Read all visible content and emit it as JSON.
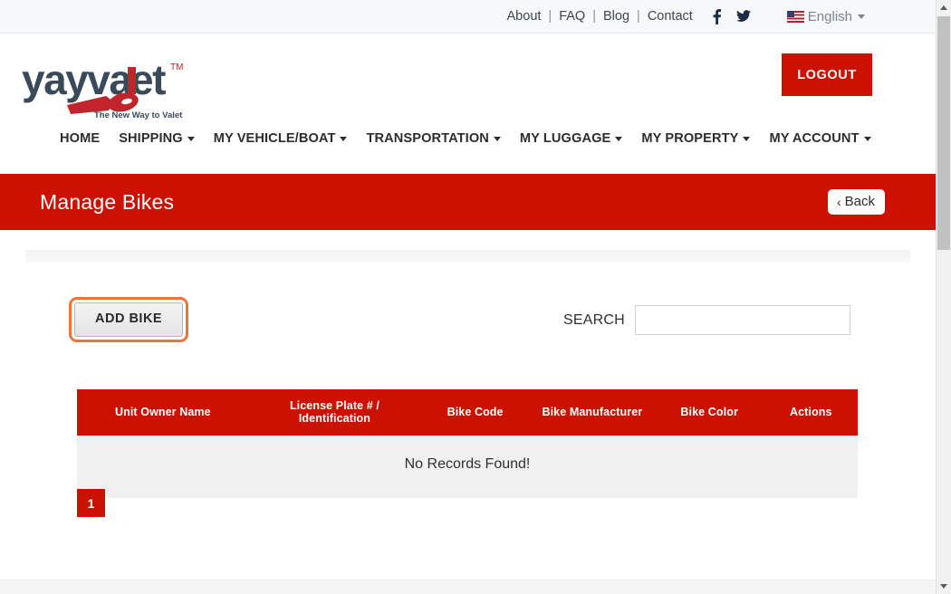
{
  "topbar": {
    "links": [
      {
        "label": "About"
      },
      {
        "label": "FAQ"
      },
      {
        "label": "Blog"
      },
      {
        "label": "Contact"
      }
    ],
    "separator": "|",
    "social": [
      {
        "name": "facebook-icon",
        "label": "Facebook"
      },
      {
        "name": "twitter-icon",
        "label": "Twitter"
      }
    ],
    "language": {
      "label": "English",
      "flag": "us-flag-icon"
    }
  },
  "header": {
    "logo": {
      "text": "yayvalet",
      "trademark": "TM",
      "tagline": "The New Way to Valet"
    },
    "logout_label": "LOGOUT",
    "nav": [
      {
        "label": "HOME",
        "has_caret": false
      },
      {
        "label": "SHIPPING",
        "has_caret": true
      },
      {
        "label": "MY VEHICLE/BOAT",
        "has_caret": true
      },
      {
        "label": "TRANSPORTATION",
        "has_caret": true
      },
      {
        "label": "MY LUGGAGE",
        "has_caret": true
      },
      {
        "label": "MY PROPERTY",
        "has_caret": true
      },
      {
        "label": "MY ACCOUNT",
        "has_caret": true
      }
    ]
  },
  "banner": {
    "title": "Manage Bikes",
    "back_label": "Back",
    "back_chevron": "‹"
  },
  "toolbar": {
    "add_bike_label": "ADD BIKE",
    "search_label": "SEARCH",
    "search_value": "",
    "search_placeholder": ""
  },
  "table": {
    "columns": [
      "Unit Owner Name",
      "License Plate # / Identification",
      "Bike Code",
      "Bike Manufacturer",
      "Bike Color",
      "Actions"
    ],
    "rows": [],
    "empty_message": "No Records Found!"
  },
  "pagination": {
    "pages": [
      {
        "label": "1",
        "active": true
      }
    ]
  },
  "colors": {
    "brand_red": "#CC1100",
    "focus_orange": "#F37335",
    "topbar_bg": "#F6F8FA",
    "empty_row_bg": "#F0F0F0",
    "logo_navy": "#3A4A5A"
  }
}
